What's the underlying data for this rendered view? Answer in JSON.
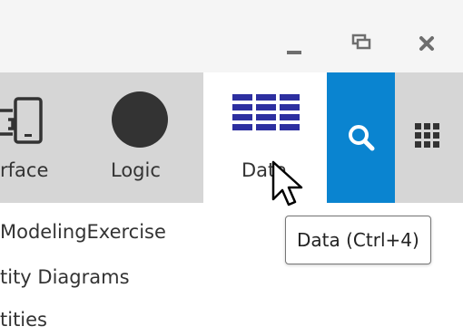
{
  "window_controls": {
    "minimize_icon": "minus-icon",
    "restore_icon": "restore-window-icon",
    "close_icon": "close-icon"
  },
  "toolbar": {
    "items": [
      {
        "label": "rface",
        "icon": "device-icon",
        "active": false
      },
      {
        "label": "Logic",
        "icon": "circle-icon",
        "active": false
      },
      {
        "label": "Data",
        "icon": "data-grid-icon",
        "active": true
      }
    ],
    "search_icon": "search-icon",
    "apps_icon": "apps-grid-icon"
  },
  "list": {
    "items": [
      {
        "label": "ModelingExercise"
      },
      {
        "label": "tity Diagrams"
      },
      {
        "label": "tities"
      }
    ]
  },
  "tooltip": {
    "text": "Data (Ctrl+4)"
  },
  "colors": {
    "toolbar_bg": "#d6d6d6",
    "active_tab_bg": "#ffffff",
    "search_bg": "#0a84d0",
    "data_icon": "#2d2fa0",
    "logic_icon": "#333333"
  }
}
